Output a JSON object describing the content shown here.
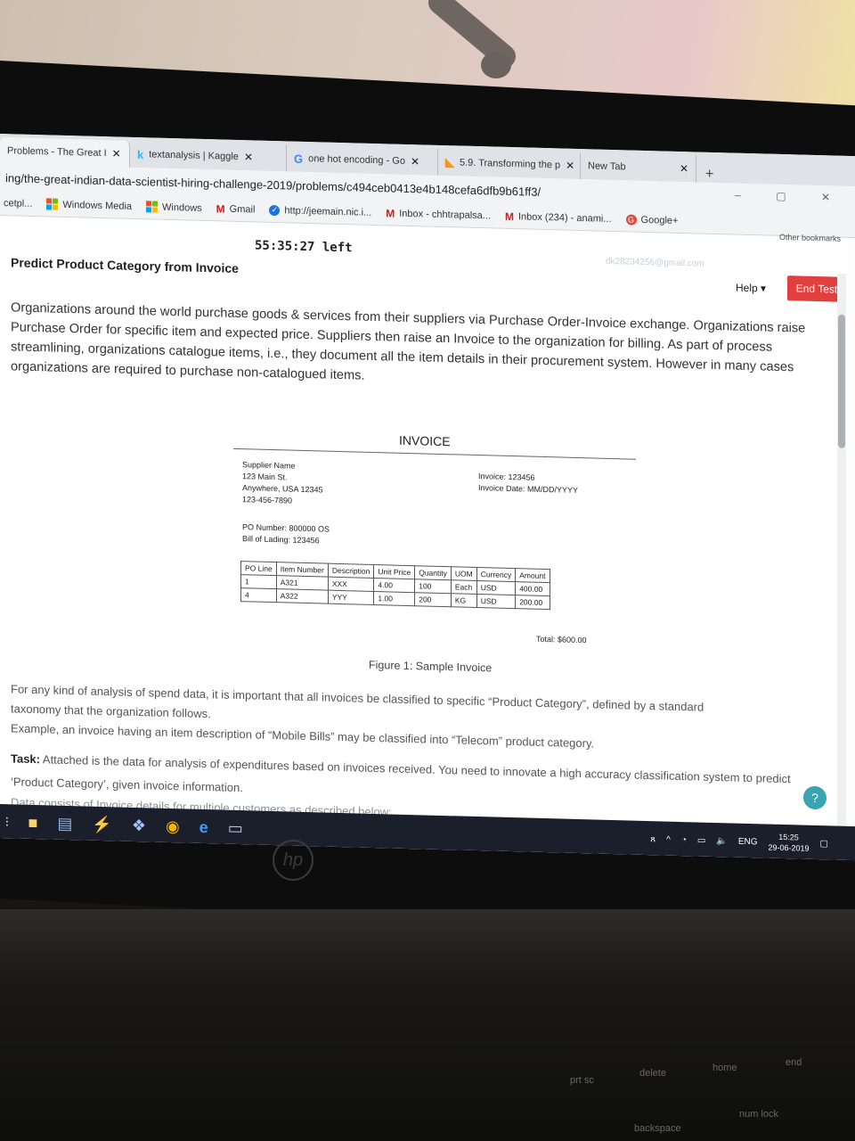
{
  "browser": {
    "tabs": [
      {
        "label": "Problems - The Great I",
        "icon": "page-icon"
      },
      {
        "label": "textanalysis | Kaggle",
        "icon": "kaggle-icon"
      },
      {
        "label": "one hot encoding - Go",
        "icon": "google-icon"
      },
      {
        "label": "5.9. Transforming the p",
        "icon": "sklearn-icon"
      },
      {
        "label": "New Tab",
        "icon": ""
      }
    ],
    "url": "ing/the-great-indian-data-scientist-hiring-challenge-2019/problems/c494ceb0413e4b148cefa6dfb9b61ff3/",
    "bookmarks": [
      {
        "label": "cetpl..."
      },
      {
        "label": "Windows Media"
      },
      {
        "label": "Windows"
      },
      {
        "label": "Gmail"
      },
      {
        "label": "http://jeemain.nic.i..."
      },
      {
        "label": "Inbox - chhtrapalsa..."
      },
      {
        "label": "Inbox (234) - anami..."
      },
      {
        "label": "Google+"
      }
    ],
    "other_bookmarks": "Other bookmarks"
  },
  "page": {
    "timer": "55:35:27 left",
    "title": "Predict Product Category from Invoice",
    "user_email": "dk28234256@gmail.com",
    "help_label": "Help ▾",
    "end_test_label": "End Test",
    "intro": "Organizations around the world purchase goods & services from their suppliers via Purchase Order-Invoice exchange. Organizations raise Purchase Order for specific item and expected price. Suppliers then raise an Invoice to the organization for billing. As part of process streamlining, organizations catalogue items, i.e., they document all the item details in their procurement system. However in many cases organizations are required to purchase non-catalogued items.",
    "caption": "Figure 1: Sample Invoice",
    "para2_line1": "For any kind of analysis of spend data, it is important that all invoices be classified to specific “Product Category”, defined by a standard",
    "para2_line2": "taxonomy that the organization follows.",
    "para2_line3": "Example, an invoice having an item description of “Mobile Bills” may be classified into “Telecom” product category.",
    "task_label": "Task:",
    "task_text": " Attached is the data for analysis of expenditures based on invoices received. You need to innovate a high accuracy classification system to predict ‘Product Category’, given invoice information.",
    "para4": "Data consists of Invoice details for multiple customers as described below:"
  },
  "invoice": {
    "title": "INVOICE",
    "supplier_lines": [
      "Supplier Name",
      "123 Main St.",
      "Anywhere, USA 12345",
      "123-456-7890"
    ],
    "meta_lines": [
      "Invoice: 123456",
      "Invoice Date: MM/DD/YYYY"
    ],
    "po_lines": [
      "PO Number: 800000 OS",
      "Bill of Lading: 123456"
    ],
    "columns": [
      "PO Line",
      "Item Number",
      "Description",
      "Unit Price",
      "Quantity",
      "UOM",
      "Currency",
      "Amount"
    ],
    "rows": [
      [
        "1",
        "A321",
        "XXX",
        "4.00",
        "100",
        "Each",
        "USD",
        "400.00"
      ],
      [
        "4",
        "A322",
        "YYY",
        "1.00",
        "200",
        "KG",
        "USD",
        "200.00"
      ]
    ],
    "total": "Total: $600.00"
  },
  "taskbar": {
    "lang": "ENG",
    "time": "15:25",
    "date": "29-06-2019"
  },
  "keyboard": {
    "keys": [
      "prt sc",
      "delete",
      "home",
      "end",
      "backspace",
      "num lock"
    ]
  }
}
